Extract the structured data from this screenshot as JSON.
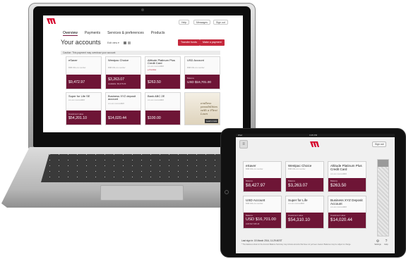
{
  "brand": {
    "accent": "#c5283c",
    "card_footer": "#6e1536"
  },
  "laptop": {
    "util_buttons": [
      "Help",
      "Messages",
      "Sign out"
    ],
    "nav": [
      "Overview",
      "Payments",
      "Services & preferences",
      "Products"
    ],
    "page_title": "Your accounts",
    "edit_view": "Edit view ▾",
    "transfer_button": "Transfer funds",
    "payment_button": "Make a payment",
    "caution": "Caution: This payment may overdraw your account",
    "cards": [
      {
        "name": "eSaver",
        "bsb": "BSB 032-xxx number",
        "footer_label": "",
        "amount": "$9,472.97",
        "sub": ""
      },
      {
        "name": "Westpac Choice",
        "bsb": "BSB 032-xxx number",
        "footer_label": "",
        "amount": "$3,263.07",
        "sub": "Available: $3,476.03"
      },
      {
        "name": "Altitude Platinum Plus Credit Card",
        "bsb": "xxx-xxx xxxxxx4820",
        "footer_label": "Overdue",
        "amount": "$263.50",
        "sub": ""
      },
      {
        "name": "USD Account",
        "bsb": "BSB 032-xxx number",
        "footer_label": "Balance",
        "amount": "USD $16,701.00",
        "sub": ""
      },
      {
        "name": "Super for Life SE",
        "bsb": "xxx-xxx xxxxxx4820",
        "footer_label": "Investment value",
        "amount": "$54,201.10",
        "sub": ""
      },
      {
        "name": "Business XYZ deposit account",
        "bsb": "xxx-xxx xxxxxx4820",
        "footer_label": "",
        "amount": "$14,020.44",
        "sub": ""
      },
      {
        "name": "Bank ABC 2E",
        "bsb": "xxx-xxx xxxxxx4820",
        "footer_label": "",
        "amount": "$100.00",
        "sub": ""
      }
    ],
    "ad_text": "endless possibilities with a Flexi Loan",
    "ad_button": "Learn more"
  },
  "tablet": {
    "carrier": "iPad",
    "time": "3:45 PM",
    "menu_glyph": "≡",
    "signout": "Sign out",
    "cards": [
      {
        "name": "eSaver",
        "bsb": "BSB 032-xxx number",
        "footer_label": "Balance",
        "amount": "$8,427.97",
        "sub": ""
      },
      {
        "name": "Westpac Choice",
        "bsb": "BSB 032-xxx number",
        "footer_label": "Balance",
        "amount": "$3,263.07",
        "sub": ""
      },
      {
        "name": "Altitude Platinum Plus Credit Card",
        "bsb": "xxx-xxx xxxxxx4820",
        "footer_label": "Balance",
        "amount": "$263.50",
        "sub": ""
      },
      {
        "name": "USD Account",
        "bsb": "BSB 032-xxx number",
        "footer_label": "Balance",
        "amount": "USD $16,701.00",
        "sub": "AUD $17,925.18"
      },
      {
        "name": "Super for Life",
        "bsb": "xxx-xxx xxxxxx4820",
        "footer_label": "Investment value",
        "amount": "$54,310.10",
        "sub": ""
      },
      {
        "name": "Business XYZ Deposit Account",
        "bsb": "xxx-xxx xxxxxx4820",
        "footer_label": "Investment value",
        "amount": "$14,020.44",
        "sub": ""
      }
    ],
    "last_sign_in": "Last sign in: 15 March 2014, 11:29 AEST",
    "fine_print": "* The balances shown in the Account Balance Summary may include amounts that have not yet been cleared. Balances may be subject to change.",
    "settings_label": "Settings",
    "help_label": "Help"
  }
}
